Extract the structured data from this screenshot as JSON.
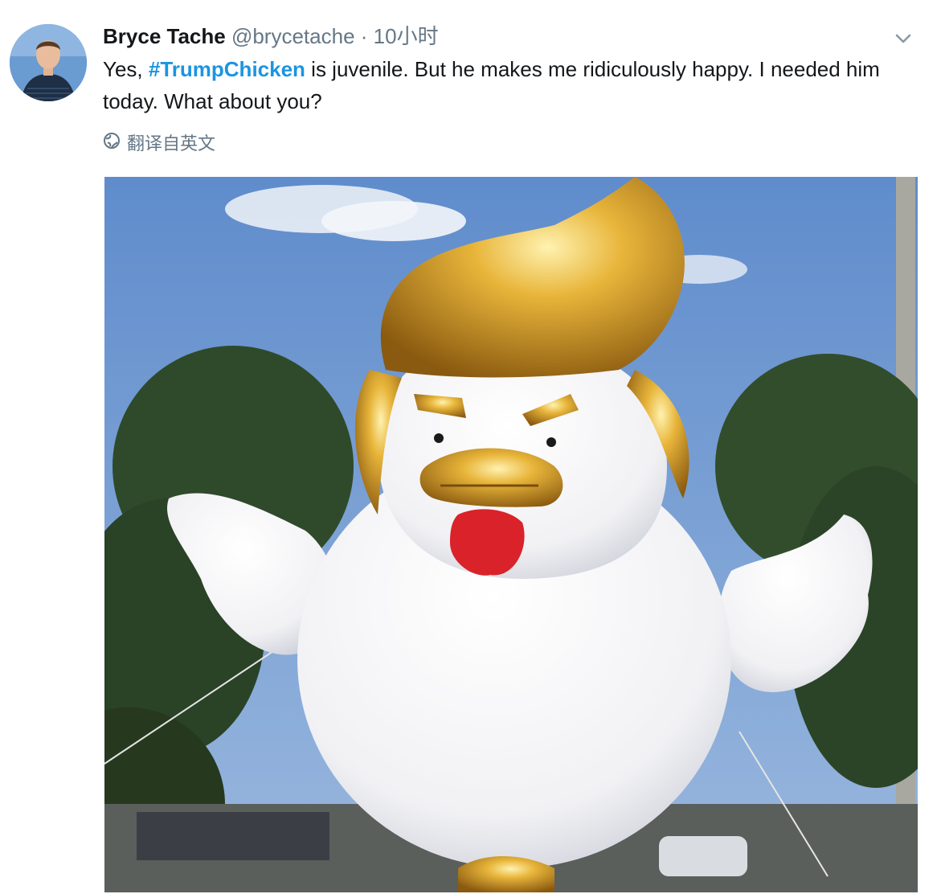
{
  "tweet": {
    "author_name": "Bryce Tache",
    "author_handle": "@brycetache",
    "separator": "·",
    "time": "10小时",
    "text_before": "Yes, ",
    "hashtag": "#TrumpChicken",
    "text_after": " is juvenile.  But he makes me ridiculously happy. I needed him today. What about you?",
    "translate_label": "翻译自英文"
  },
  "icons": {
    "menu": "chevron-down-icon",
    "translate": "globe-icon",
    "avatar": "user-avatar"
  },
  "colors": {
    "link": "#1b95e0",
    "secondary_text": "#657786",
    "primary_text": "#14171a"
  }
}
